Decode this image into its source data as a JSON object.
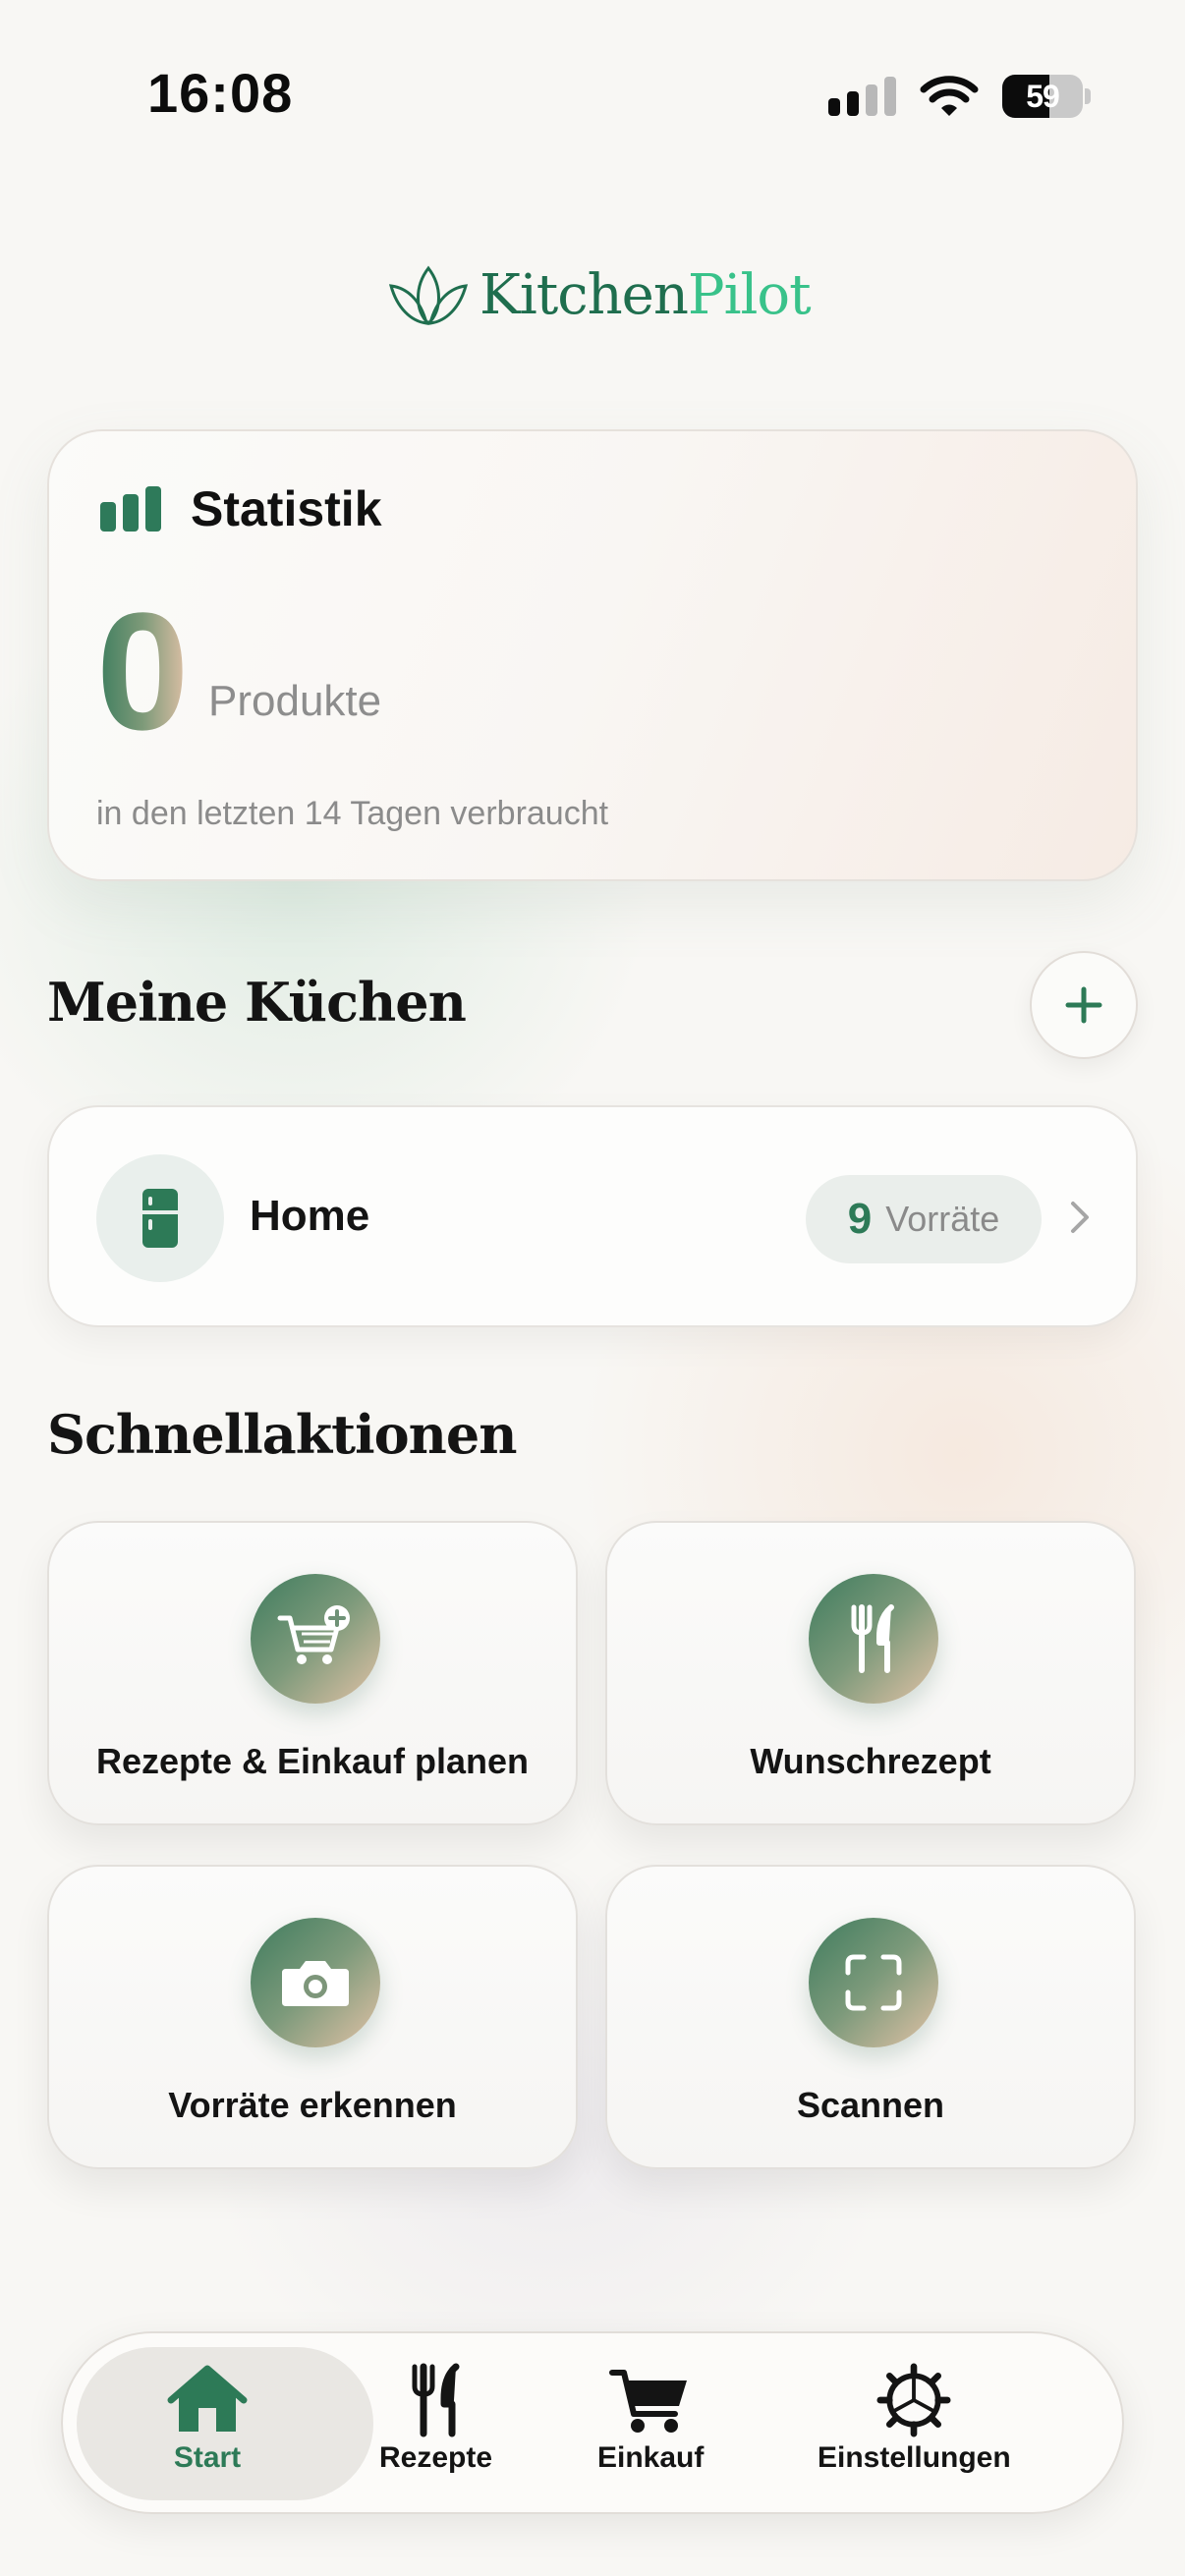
{
  "status_bar": {
    "time": "16:08",
    "battery_level": "59",
    "signal_bars": 2,
    "signal_max": 4
  },
  "app": {
    "logo_part1": "Kitchen",
    "logo_part2": "Pilot",
    "brand_color": "#2d7a57",
    "accent_color": "#39c28a"
  },
  "stats": {
    "title": "Statistik",
    "count": "0",
    "unit": "Produkte",
    "note": "in den letzten 14 Tagen verbraucht"
  },
  "kitchens": {
    "section_title": "Meine Küchen",
    "add_icon": "plus-icon",
    "items": [
      {
        "name": "Home",
        "icon": "fridge-icon",
        "count": "9",
        "count_label": "Vorräte"
      }
    ]
  },
  "quick_actions": {
    "section_title": "Schnellaktionen",
    "items": [
      {
        "label": "Rezepte & Einkauf planen",
        "icon": "cart-plus-icon"
      },
      {
        "label": "Wunschrezept",
        "icon": "fork-knife-icon"
      },
      {
        "label": "Vorräte erkennen",
        "icon": "camera-icon"
      },
      {
        "label": "Scannen",
        "icon": "scan-frame-icon"
      }
    ]
  },
  "tab_bar": {
    "active": "Start",
    "tabs": [
      {
        "label": "Start",
        "icon": "house-icon"
      },
      {
        "label": "Rezepte",
        "icon": "fork-knife-icon"
      },
      {
        "label": "Einkauf",
        "icon": "cart-icon"
      },
      {
        "label": "Einstellungen",
        "icon": "gear-icon"
      }
    ]
  }
}
